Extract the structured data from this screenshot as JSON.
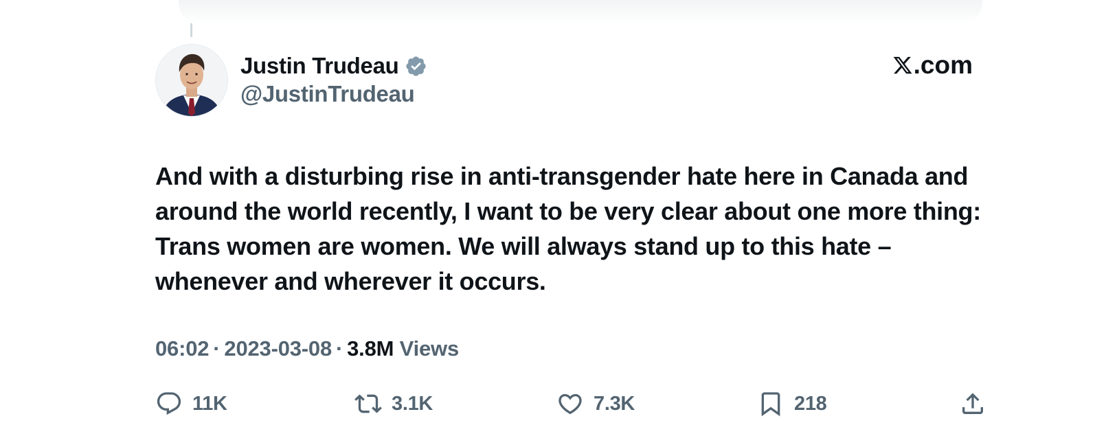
{
  "author": {
    "name": "Justin Trudeau",
    "handle": "@JustinTrudeau",
    "verified": true,
    "badge_color": "#829aab",
    "avatar_icon": "profile-photo"
  },
  "brand": {
    "label": ".com",
    "logo_icon": "x-logo"
  },
  "tweet": {
    "text": "And with a disturbing rise in anti-transgender hate here in Canada and around the world recently, I want to be very clear about one more thing: Trans women are women. We will always stand up to this hate – whenever and wherever it occurs."
  },
  "meta": {
    "time": "06:02",
    "separator": "·",
    "date": "2023-03-08",
    "views_count": "3.8M",
    "views_label": "Views"
  },
  "actions": {
    "reply": {
      "icon": "reply-icon",
      "count": "11K"
    },
    "retweet": {
      "icon": "retweet-icon",
      "count": "3.1K"
    },
    "like": {
      "icon": "heart-icon",
      "count": "7.3K"
    },
    "bookmark": {
      "icon": "bookmark-icon",
      "count": "218"
    },
    "share": {
      "icon": "share-icon"
    }
  },
  "colors": {
    "text_primary": "#0f1419",
    "text_secondary": "#536471"
  }
}
